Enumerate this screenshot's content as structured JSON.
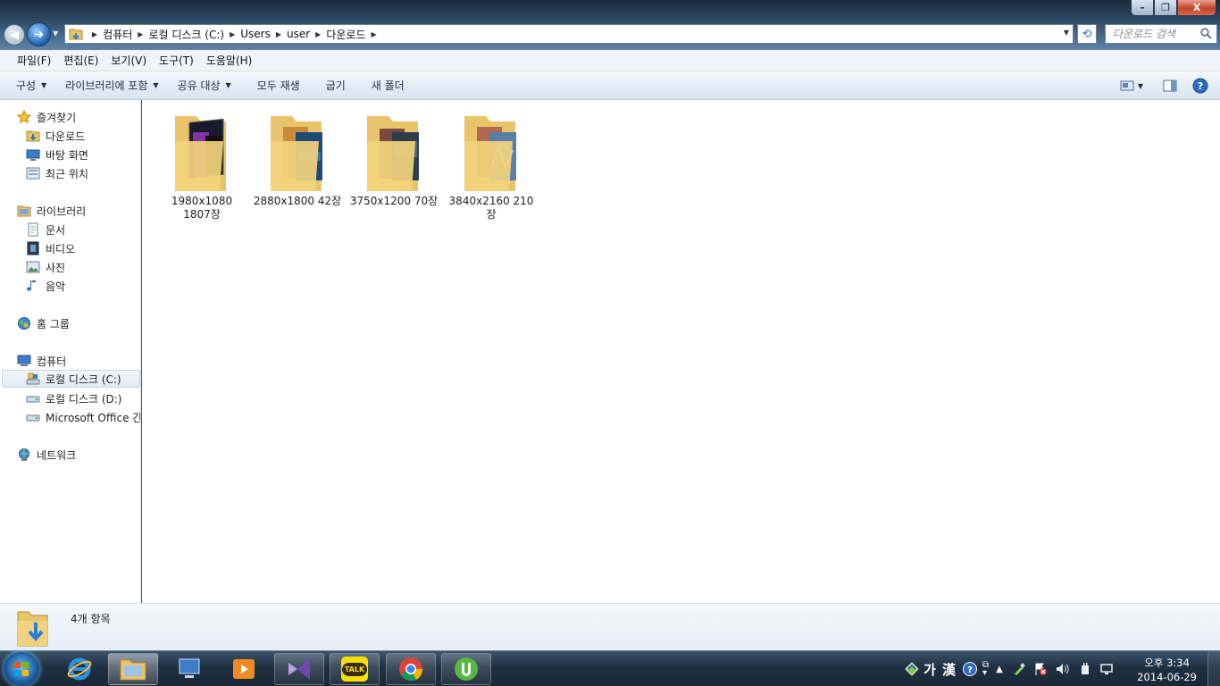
{
  "window": {
    "controls": {
      "minimize": "–",
      "maximize": "❐",
      "close": "X"
    }
  },
  "address": {
    "breadcrumbs": [
      "컴퓨터",
      "로컬 디스크 (C:)",
      "Users",
      "user",
      "다운로드"
    ]
  },
  "search": {
    "placeholder": "다운로드 검색"
  },
  "menu": {
    "items": [
      "파일(F)",
      "편집(E)",
      "보기(V)",
      "도구(T)",
      "도움말(H)"
    ]
  },
  "commands": {
    "organize": "구성",
    "include_library": "라이브러리에 포함",
    "share": "공유 대상",
    "play_all": "모두 재생",
    "burn": "굽기",
    "new_folder": "새 폴더"
  },
  "nav": {
    "favorites": "즐겨찾기",
    "downloads": "다운로드",
    "desktop": "바탕 화면",
    "recent": "최근 위치",
    "libraries": "라이브러리",
    "documents": "문서",
    "videos": "비디오",
    "pictures": "사진",
    "music": "음악",
    "homegroup": "홈 그룹",
    "computer": "컴퓨터",
    "drive_c": "로컬 디스크 (C:)",
    "drive_d": "로컬 디스크 (D:)",
    "office": "Microsoft Office 간편 실행",
    "network": "네트워크"
  },
  "folders": [
    {
      "line1": "1980x1080",
      "line2": "1807장"
    },
    {
      "line1": "2880x1800 42장",
      "line2": ""
    },
    {
      "line1": "3750x1200 70장",
      "line2": ""
    },
    {
      "line1": "3840x2160 210",
      "line2": "장"
    }
  ],
  "status": {
    "item_count": "4개 항목"
  },
  "taskbar": {
    "ime": "가 漢",
    "time": "오후 3:34",
    "date": "2014-06-29",
    "kakao_label": "TALK"
  }
}
